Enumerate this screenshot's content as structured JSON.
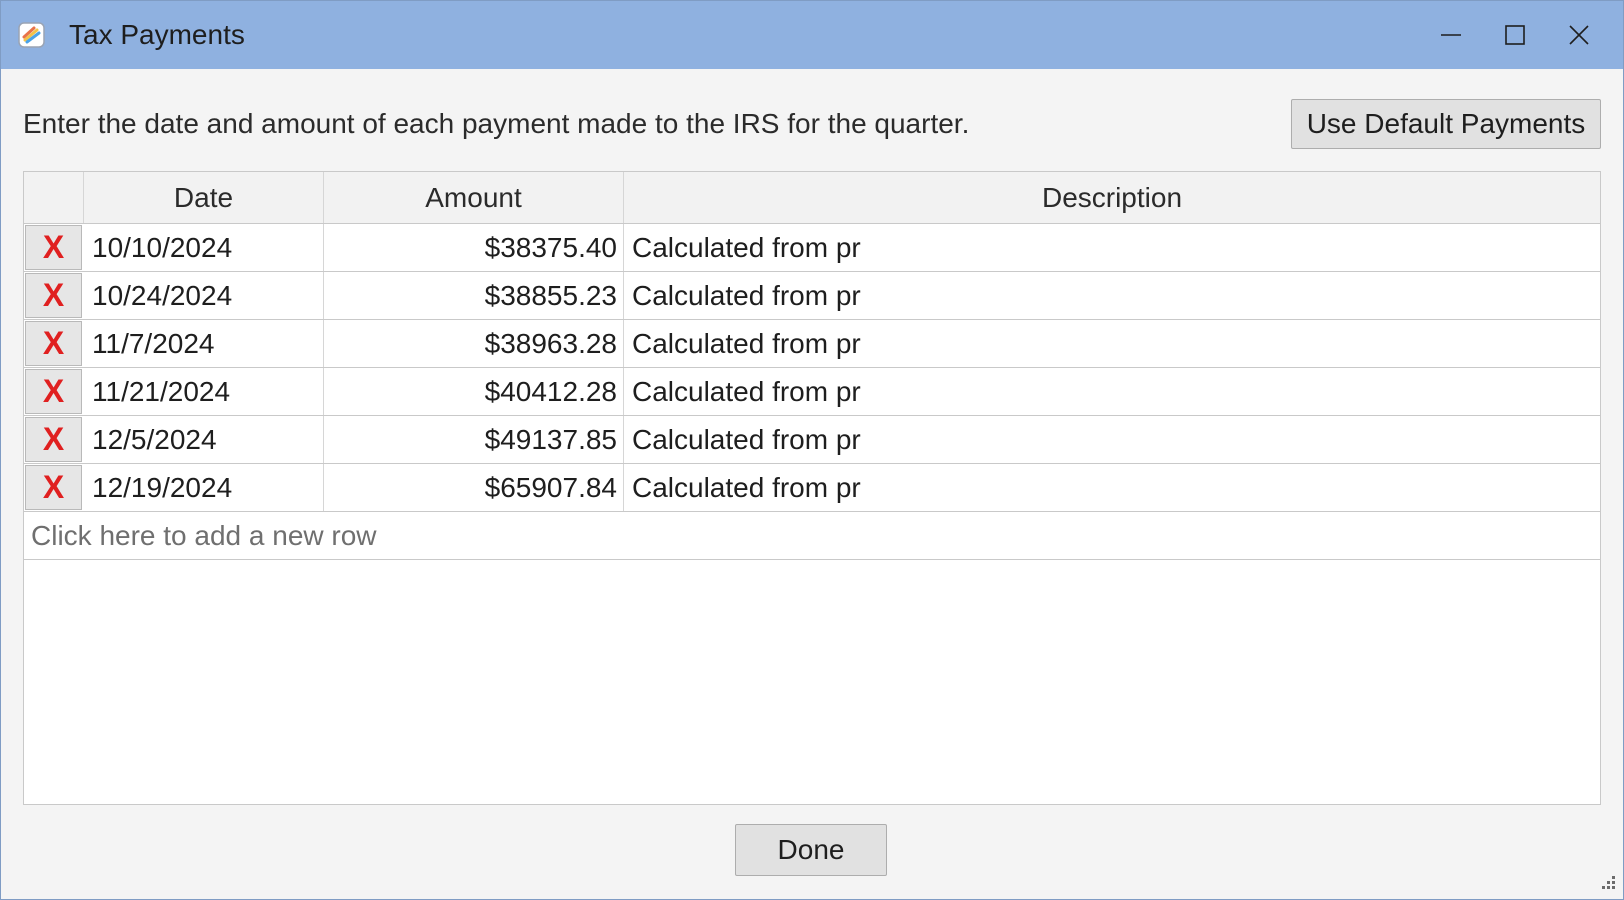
{
  "window": {
    "title": "Tax Payments",
    "titlebar_color": "#8fb1e0"
  },
  "icons": {
    "app": "app-icon",
    "minimize": "minimize-icon",
    "maximize": "maximize-icon",
    "close": "close-icon",
    "delete": "delete-x-icon",
    "resize": "resize-grip-icon"
  },
  "instructions": "Enter the date and amount of each payment made to the IRS for the quarter.",
  "default_button_label": "Use Default Payments",
  "grid": {
    "columns": [
      "",
      "Date",
      "Amount",
      "Description"
    ],
    "rows": [
      {
        "delete_label": "X",
        "date": "10/10/2024",
        "amount": "$38375.40",
        "description": "Calculated from pr"
      },
      {
        "delete_label": "X",
        "date": "10/24/2024",
        "amount": "$38855.23",
        "description": "Calculated from pr"
      },
      {
        "delete_label": "X",
        "date": "11/7/2024",
        "amount": "$38963.28",
        "description": "Calculated from pr"
      },
      {
        "delete_label": "X",
        "date": "11/21/2024",
        "amount": "$40412.28",
        "description": "Calculated from pr"
      },
      {
        "delete_label": "X",
        "date": "12/5/2024",
        "amount": "$49137.85",
        "description": "Calculated from pr"
      },
      {
        "delete_label": "X",
        "date": "12/19/2024",
        "amount": "$65907.84",
        "description": "Calculated from pr"
      }
    ],
    "add_row_text": "Click here to add a new row",
    "delete_color": "#e02020"
  },
  "done_button_label": "Done"
}
